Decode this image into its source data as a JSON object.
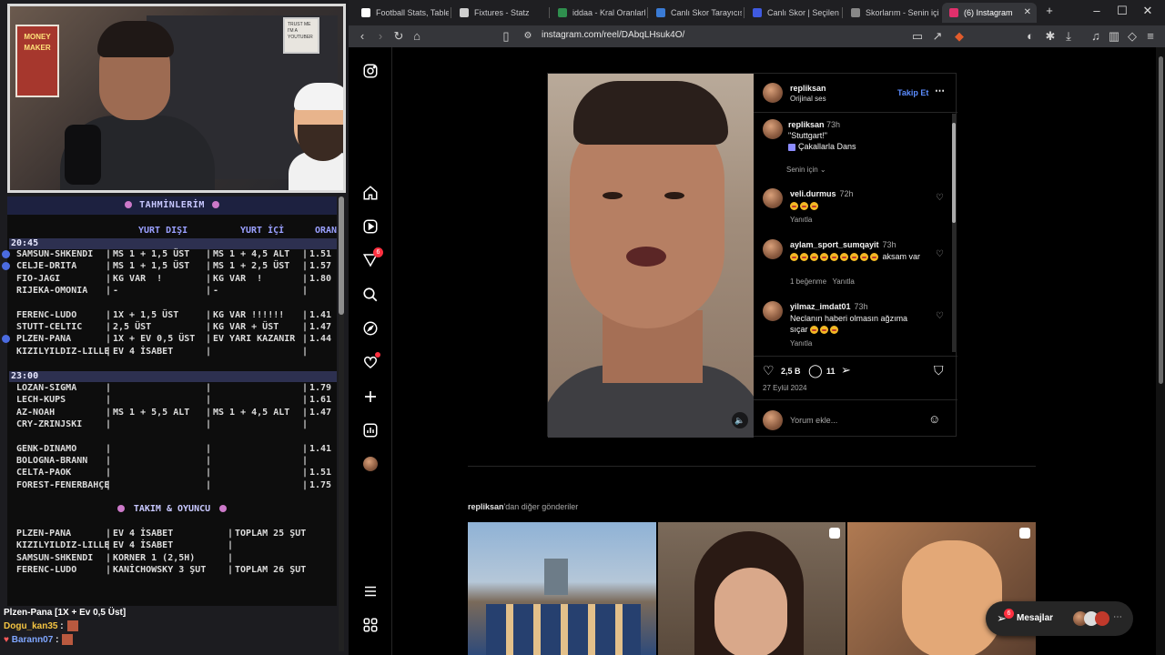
{
  "stream": {
    "predictions_title": "TAHMİNLERİM",
    "col_yurt_disi": "YURT DIŞI",
    "col_yurt_ici": "YURT İÇİ",
    "col_oran": "ORAN",
    "time1": "20:45",
    "time2": "23:00",
    "rows": [
      {
        "match": "SAMSUN-SHKENDI",
        "yd": "MS 1 + 1,5 ÜST",
        "yi": "MS 1 + 4,5 ALT",
        "oran": "1.51"
      },
      {
        "match": "CELJE-DRITA",
        "yd": "MS 1 + 1,5 ÜST",
        "yi": "MS 1 + 2,5 ÜST",
        "oran": "1.57"
      },
      {
        "match": "FIO-JAGI",
        "yd": "KG VAR  !",
        "yi": "KG VAR  !",
        "oran": "1.80"
      },
      {
        "match": "RIJEKA-OMONIA",
        "yd": "-",
        "yi": "-",
        "oran": ""
      },
      {
        "match": "FERENC-LUDO",
        "yd": "1X + 1,5 ÜST",
        "yi": "KG VAR !!!!!!",
        "oran": "1.41"
      },
      {
        "match": "STUTT-CELTIC",
        "yd": "2,5 ÜST",
        "yi": "KG VAR + ÜST",
        "oran": "1.47"
      },
      {
        "match": "PLZEN-PANA",
        "yd": "1X + EV 0,5 ÜST",
        "yi": "EV YARI KAZANIR",
        "oran": "1.44"
      },
      {
        "match": "KIZILYILDIZ-LILLE",
        "yd": "EV 4 İSABET",
        "yi": "",
        "oran": ""
      },
      {
        "match": "LOZAN-SIGMA",
        "yd": "",
        "yi": "",
        "oran": "1.79"
      },
      {
        "match": "LECH-KUPS",
        "yd": "",
        "yi": "",
        "oran": "1.61"
      },
      {
        "match": "AZ-NOAH",
        "yd": "MS 1 + 5,5 ALT",
        "yi": "MS 1 + 4,5 ALT",
        "oran": "1.47"
      },
      {
        "match": "CRY-ZRINJSKI",
        "yd": "",
        "yi": "",
        "oran": ""
      },
      {
        "match": "GENK-DINAMO",
        "yd": "",
        "yi": "",
        "oran": "1.41"
      },
      {
        "match": "BOLOGNA-BRANN",
        "yd": "",
        "yi": "",
        "oran": ""
      },
      {
        "match": "CELTA-PAOK",
        "yd": "",
        "yi": "",
        "oran": "1.51"
      },
      {
        "match": "FOREST-FENERBAHÇE",
        "yd": "",
        "yi": "",
        "oran": "1.75"
      }
    ],
    "section2_title": "TAKIM & OYUNCU",
    "rows2": [
      {
        "match": "PLZEN-PANA",
        "yd": "EV 4 İSABET",
        "extra": "TOPLAM 25 ŞUT"
      },
      {
        "match": "KIZILYILDIZ-LILLE",
        "yd": "EV 4 İSABET",
        "extra": ""
      },
      {
        "match": "SAMSUN-SHKENDI",
        "yd": "KORNER 1 (2,5H)",
        "extra": ""
      },
      {
        "match": "FERENC-LUDO",
        "yd": "KANİCHOWSKY 3 ŞUT",
        "extra": "TOPLAM 26 ŞUT"
      }
    ],
    "chat": [
      {
        "user": "",
        "text": "Plzen-Pana [1X + Ev 0,5 Üst]"
      },
      {
        "user": "Dogu_kan35",
        "text": ":"
      },
      {
        "user": "Barann07",
        "text": ":"
      }
    ],
    "webcam_sign": "TRUST ME I'M A YOUTUBER",
    "poster_text": "MONEY MAKER"
  },
  "browser": {
    "tabs": [
      {
        "label": "Football Stats, Tables",
        "icon_color": "#ffffff"
      },
      {
        "label": "Fixtures - Statz",
        "icon_color": "#cfcfcf"
      },
      {
        "label": "iddaa - Kral Oranlarla",
        "icon_color": "#2f8f4e"
      },
      {
        "label": "Canlı Skor Tarayıcısı",
        "icon_color": "#3a7bd5"
      },
      {
        "label": "Canlı Skor | Seçilen m",
        "icon_color": "#3f5ae0"
      },
      {
        "label": "Skorlarım - Senin için",
        "icon_color": "#888888"
      },
      {
        "label": "(6) Instagram",
        "icon_color": "#e1306c"
      }
    ],
    "url": "instagram.com/reel/DAbqLHsuk4O/"
  },
  "instagram": {
    "post": {
      "author": "repliksan",
      "audio": "Orijinal ses",
      "follow": "Takip Et",
      "caption_user": "repliksan",
      "caption_time": "73h",
      "caption_line1": "\"Stuttgart!\"",
      "caption_line2": "Çakallarla Dans",
      "filter": "Senin için",
      "comments": [
        {
          "user": "veli.durmus",
          "time": "72h",
          "text": "",
          "emojis": 3,
          "meta": "Yanıtla"
        },
        {
          "user": "aylam_sport_sumqayit",
          "time": "73h",
          "text": "aksam var",
          "emojis": 9,
          "meta": "1 beğenme   Yanıtla"
        },
        {
          "user": "yilmaz_imdat01",
          "time": "73h",
          "text": "Neclanın haberi olmasın ağzıma sıçar",
          "emojis": 3,
          "meta": "Yanıtla"
        }
      ],
      "likes": "2,5 B",
      "comment_count": "11",
      "date": "27 Eylül 2024",
      "comment_placeholder": "Yorum ekle..."
    },
    "more_from_user": "repliksan",
    "more_from_suffix": "'dan diğer gönderiler",
    "messages_label": "Mesajlar",
    "messages_badge": "6",
    "notification_badge": "6"
  }
}
